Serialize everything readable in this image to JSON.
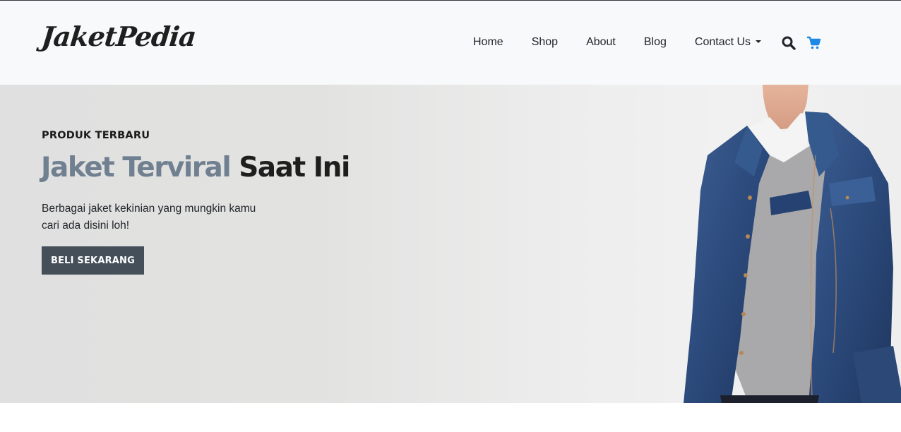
{
  "header": {
    "brand": "JaketPedia",
    "nav": [
      {
        "label": "Home"
      },
      {
        "label": "Shop"
      },
      {
        "label": "About"
      },
      {
        "label": "Blog"
      },
      {
        "label": "Contact Us"
      }
    ],
    "icons": {
      "search": "search-icon",
      "cart": "cart-icon"
    },
    "cart_color": "#1e88e5"
  },
  "hero": {
    "eyebrow": "PRODUK TERBARU",
    "headline_accent": "Jaket Terviral",
    "headline_rest": "Saat Ini",
    "description_line1": "Berbagai jaket kekinian yang mungkin kamu",
    "description_line2": "cari ada disini loh!",
    "button": "BELI SEKARANG",
    "accent_color": "#708090",
    "button_color": "#444f5a"
  }
}
